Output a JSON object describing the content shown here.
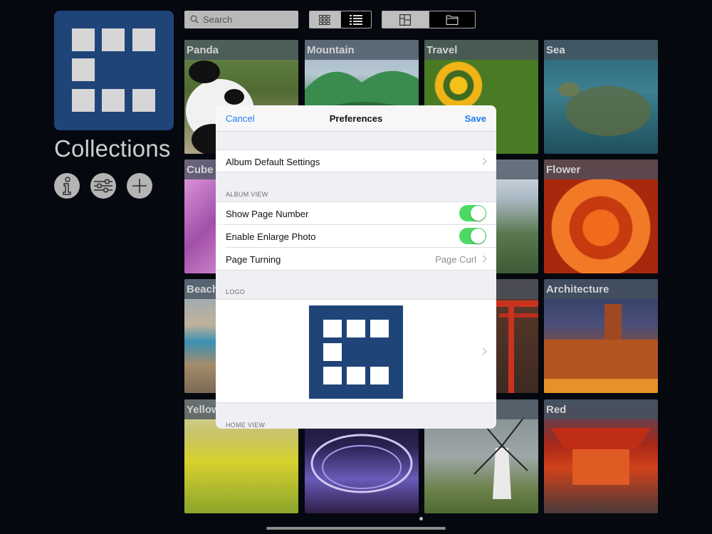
{
  "sidebar": {
    "title": "Collections",
    "buttons": [
      "info-icon",
      "sliders-icon",
      "plus-icon"
    ],
    "logo_color": "#1e4478"
  },
  "toolbar": {
    "search_placeholder": "Search",
    "grid_view_icon": "grid-icon",
    "list_view_icon": "list-icon",
    "layout_icon": "layout-icon",
    "folder_icon": "folder-icon"
  },
  "albums": [
    "Panda",
    "Mountain",
    "Travel",
    "Sea",
    "Cube",
    "",
    "",
    "Flower",
    "Beach",
    "",
    "",
    "Architecture",
    "Yellow",
    "",
    "",
    "Red"
  ],
  "modal": {
    "cancel": "Cancel",
    "title": "Preferences",
    "save": "Save",
    "album_default_settings": "Album Default Settings",
    "section_album_view": "ALBUM VIEW",
    "show_page_number": "Show Page Number",
    "show_page_number_on": true,
    "enable_enlarge_photo": "Enable Enlarge Photo",
    "enable_enlarge_photo_on": true,
    "page_turning": "Page Turning",
    "page_turning_value": "Page Curl",
    "section_logo": "LOGO",
    "section_home_view": "HOME VIEW"
  },
  "colors": {
    "accent": "#1e7cf3",
    "toggle_on": "#4cd964",
    "brand": "#1e4478"
  }
}
